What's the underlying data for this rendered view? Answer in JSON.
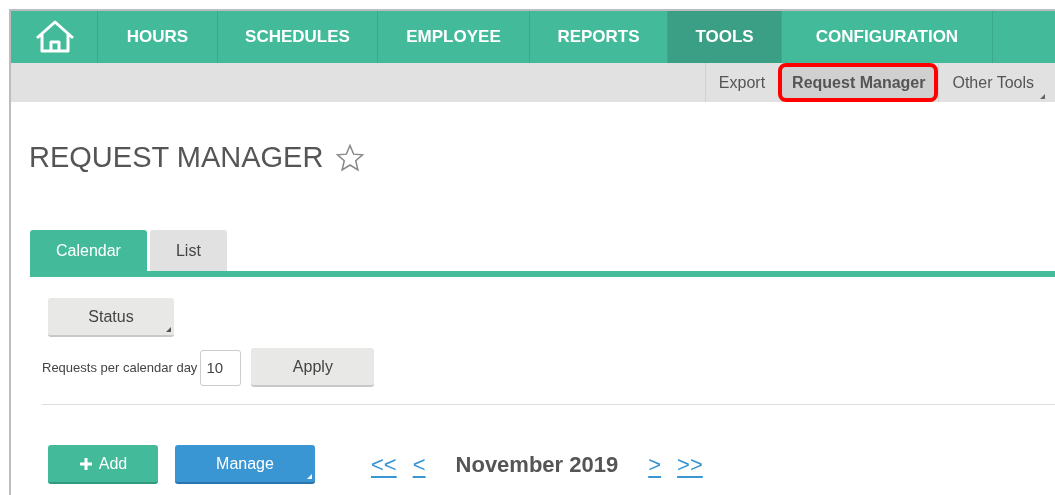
{
  "nav": [
    {
      "kind": "home",
      "selected": false
    },
    {
      "kind": "text",
      "label": "HOURS",
      "selected": false
    },
    {
      "kind": "text",
      "label": "SCHEDULES",
      "selected": false
    },
    {
      "kind": "text",
      "label": "EMPLOYEE",
      "selected": false
    },
    {
      "kind": "text",
      "label": "REPORTS",
      "selected": false
    },
    {
      "kind": "text",
      "label": "TOOLS",
      "selected": true
    },
    {
      "kind": "text",
      "label": "CONFIGURATION",
      "selected": false
    }
  ],
  "subnav": [
    {
      "label": "Export",
      "selected": false,
      "highlighted": false,
      "dropdown": false
    },
    {
      "label": "Request Manager",
      "selected": true,
      "highlighted": true,
      "dropdown": false
    },
    {
      "label": "Other Tools",
      "selected": false,
      "highlighted": false,
      "dropdown": true
    }
  ],
  "page_title": "REQUEST MANAGER",
  "favorite": false,
  "tabs": [
    {
      "label": "Calendar",
      "selected": true
    },
    {
      "label": "List",
      "selected": false
    }
  ],
  "status_button": "Status",
  "per_day": {
    "label": "Requests per calendar day",
    "value": "10",
    "button": "Apply"
  },
  "add_button": "Add",
  "manage_button": "Manage",
  "calendar_nav": {
    "first": "<<",
    "prev": "<",
    "month": "November 2019",
    "next": ">",
    "last": ">>"
  }
}
